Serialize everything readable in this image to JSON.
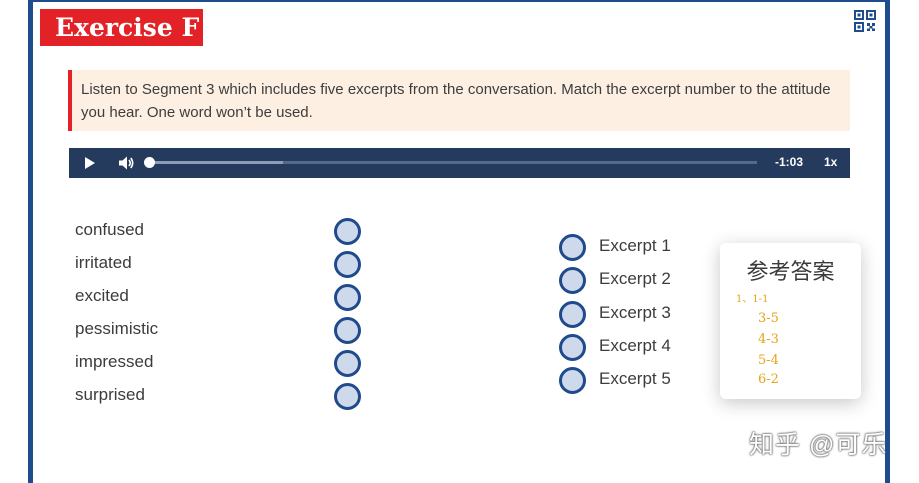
{
  "exercise": {
    "title": "Exercise F",
    "instruction": "Listen to Segment 3 which includes five excerpts from the conversation. Match the excerpt number to the attitude you hear. One word won’t be used."
  },
  "player": {
    "time_remaining": "-1:03",
    "speed": "1x",
    "progress_fraction": 0.0,
    "buffered_fraction": 0.22
  },
  "attitudes": [
    "confused",
    "irritated",
    "excited",
    "pessimistic",
    "impressed",
    "surprised"
  ],
  "excerpts": [
    "Excerpt 1",
    "Excerpt 2",
    "Excerpt 3",
    "Excerpt 4",
    "Excerpt 5"
  ],
  "answer_card": {
    "title": "参考答案",
    "lines": [
      "1、1-1",
      "3-5",
      "4-3",
      "5-4",
      "6-2"
    ]
  },
  "watermark": "知乎 @可乐",
  "colors": {
    "frame": "#1e4c8f",
    "title_badge": "#e32227",
    "player": "#253b5e",
    "answer_text": "#e5a516"
  }
}
